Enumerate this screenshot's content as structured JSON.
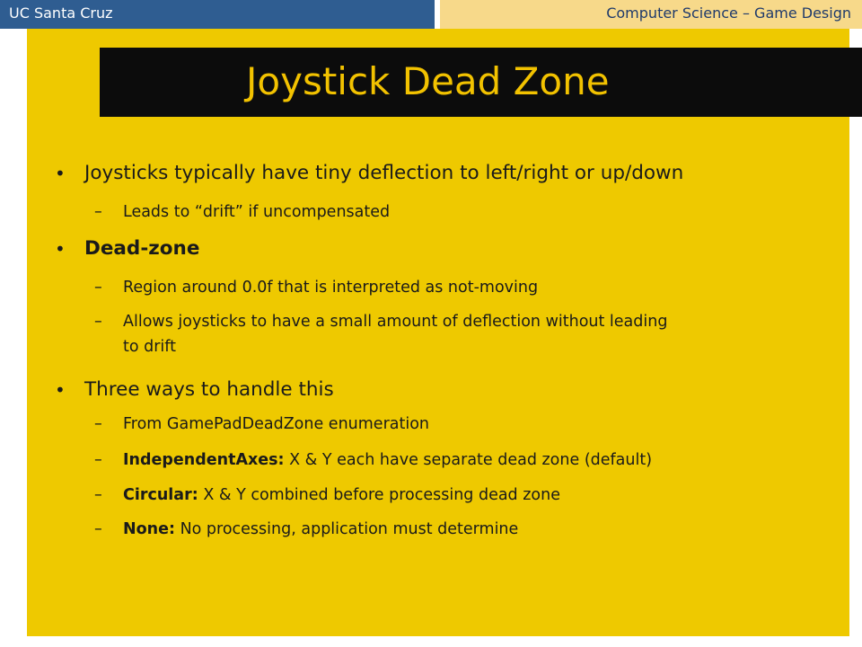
{
  "header": {
    "left_label": "UC Santa Cruz",
    "right_label": "Computer Science – Game Design"
  },
  "slide": {
    "title": "Joystick Dead Zone",
    "bullets": [
      {
        "text": "Joysticks typically have tiny deflection to left/right or up/down",
        "subs": [
          {
            "text": "Leads to “drift” if uncompensated"
          }
        ]
      },
      {
        "text": "Dead-zone",
        "subs": [
          {
            "text": "Region around 0.0f that is interpreted as not-moving"
          },
          {
            "text": "Allows joysticks to have a small amount of deflection without leading",
            "cont": "to drift"
          }
        ]
      },
      {
        "text": "Three ways to handle this",
        "subs": [
          {
            "text": "From GamePadDeadZone enumeration"
          },
          {
            "bold": "IndependentAxes:",
            "text": " X & Y each have separate dead zone (default)"
          },
          {
            "bold": "Circular:",
            "text": " X & Y combined before processing dead zone"
          },
          {
            "bold": "None:",
            "text": " No processing, application must determine"
          }
        ]
      }
    ],
    "bullet_glyph": "•",
    "dash_glyph": "–"
  },
  "colors": {
    "header_left_bg": "#2f5d91",
    "header_right_bg": "#f7d98a",
    "panel_bg": "#eec900",
    "title_bar_bg": "#0c0c0c",
    "title_text": "#f2c200"
  }
}
